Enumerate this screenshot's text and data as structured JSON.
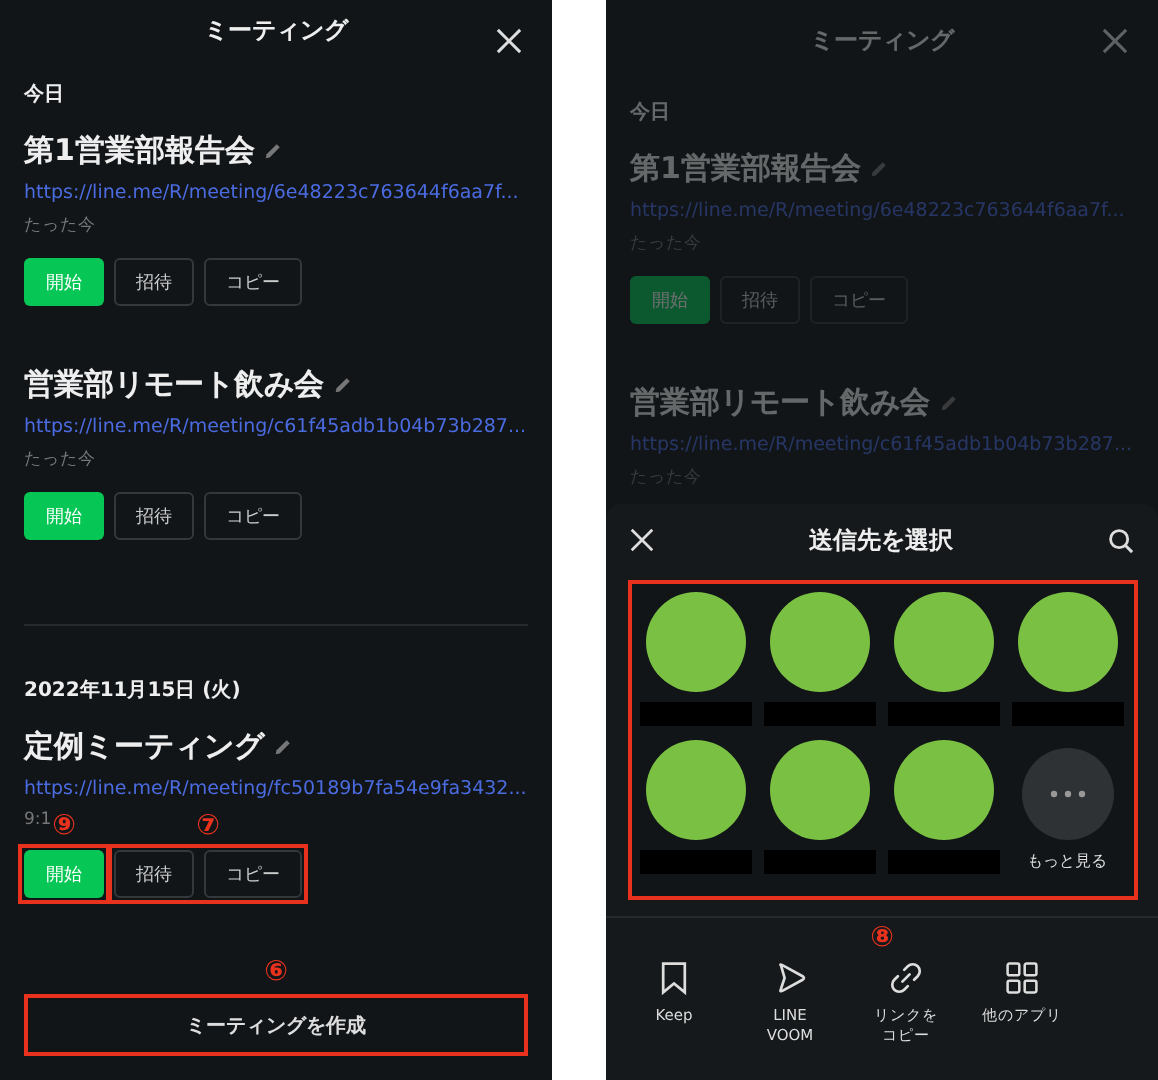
{
  "left": {
    "title": "ミーティング",
    "sections": [
      {
        "heading": "今日",
        "meetings": [
          {
            "title": "第1営業部報告会",
            "url": "https://line.me/R/meeting/6e48223c763644f6aa7f...",
            "time": "たった今",
            "buttons": [
              {
                "kind": "start",
                "label": "開始"
              },
              {
                "kind": "plain",
                "label": "招待"
              },
              {
                "kind": "plain",
                "label": "コピー"
              }
            ]
          },
          {
            "title": "営業部リモート飲み会",
            "url": "https://line.me/R/meeting/c61f45adb1b04b73b287...",
            "time": "たった今",
            "buttons": [
              {
                "kind": "start",
                "label": "開始"
              },
              {
                "kind": "plain",
                "label": "招待"
              },
              {
                "kind": "plain",
                "label": "コピー"
              }
            ]
          }
        ]
      },
      {
        "heading": "2022年11月15日 (火)",
        "meetings": [
          {
            "title": "定例ミーティング",
            "url": "https://line.me/R/meeting/fc50189b7fa54e9fa3432...",
            "time": "9:1",
            "buttons": [
              {
                "kind": "start",
                "label": "開始"
              },
              {
                "kind": "plain",
                "label": "招待"
              },
              {
                "kind": "plain",
                "label": "コピー"
              }
            ],
            "markers": {
              "start": "⑨",
              "others": "⑦"
            }
          }
        ]
      }
    ],
    "create_button": {
      "label": "ミーティングを作成",
      "marker": "⑥"
    }
  },
  "right": {
    "title": "ミーティング",
    "sections": [
      {
        "heading": "今日",
        "meetings": [
          {
            "title": "第1営業部報告会",
            "url": "https://line.me/R/meeting/6e48223c763644f6aa7f...",
            "time": "たった今",
            "buttons": [
              {
                "kind": "start",
                "label": "開始"
              },
              {
                "kind": "plain",
                "label": "招待"
              },
              {
                "kind": "plain",
                "label": "コピー"
              }
            ]
          },
          {
            "title": "営業部リモート飲み会",
            "url": "https://line.me/R/meeting/c61f45adb1b04b73b287...",
            "time": "たった今"
          }
        ]
      }
    ],
    "sheet": {
      "title": "送信先を選択",
      "marker": "⑧",
      "friends": [
        {
          "kind": "contact"
        },
        {
          "kind": "contact"
        },
        {
          "kind": "contact"
        },
        {
          "kind": "contact"
        },
        {
          "kind": "contact"
        },
        {
          "kind": "contact"
        },
        {
          "kind": "contact"
        },
        {
          "kind": "more",
          "label": "もっと見る"
        }
      ],
      "share_options": [
        {
          "kind": "bookmark",
          "label": "Keep"
        },
        {
          "kind": "play",
          "label": "LINE\nVOOM"
        },
        {
          "kind": "link",
          "label": "リンクをコピー"
        },
        {
          "kind": "apps",
          "label": "他のアプリ"
        }
      ]
    }
  }
}
